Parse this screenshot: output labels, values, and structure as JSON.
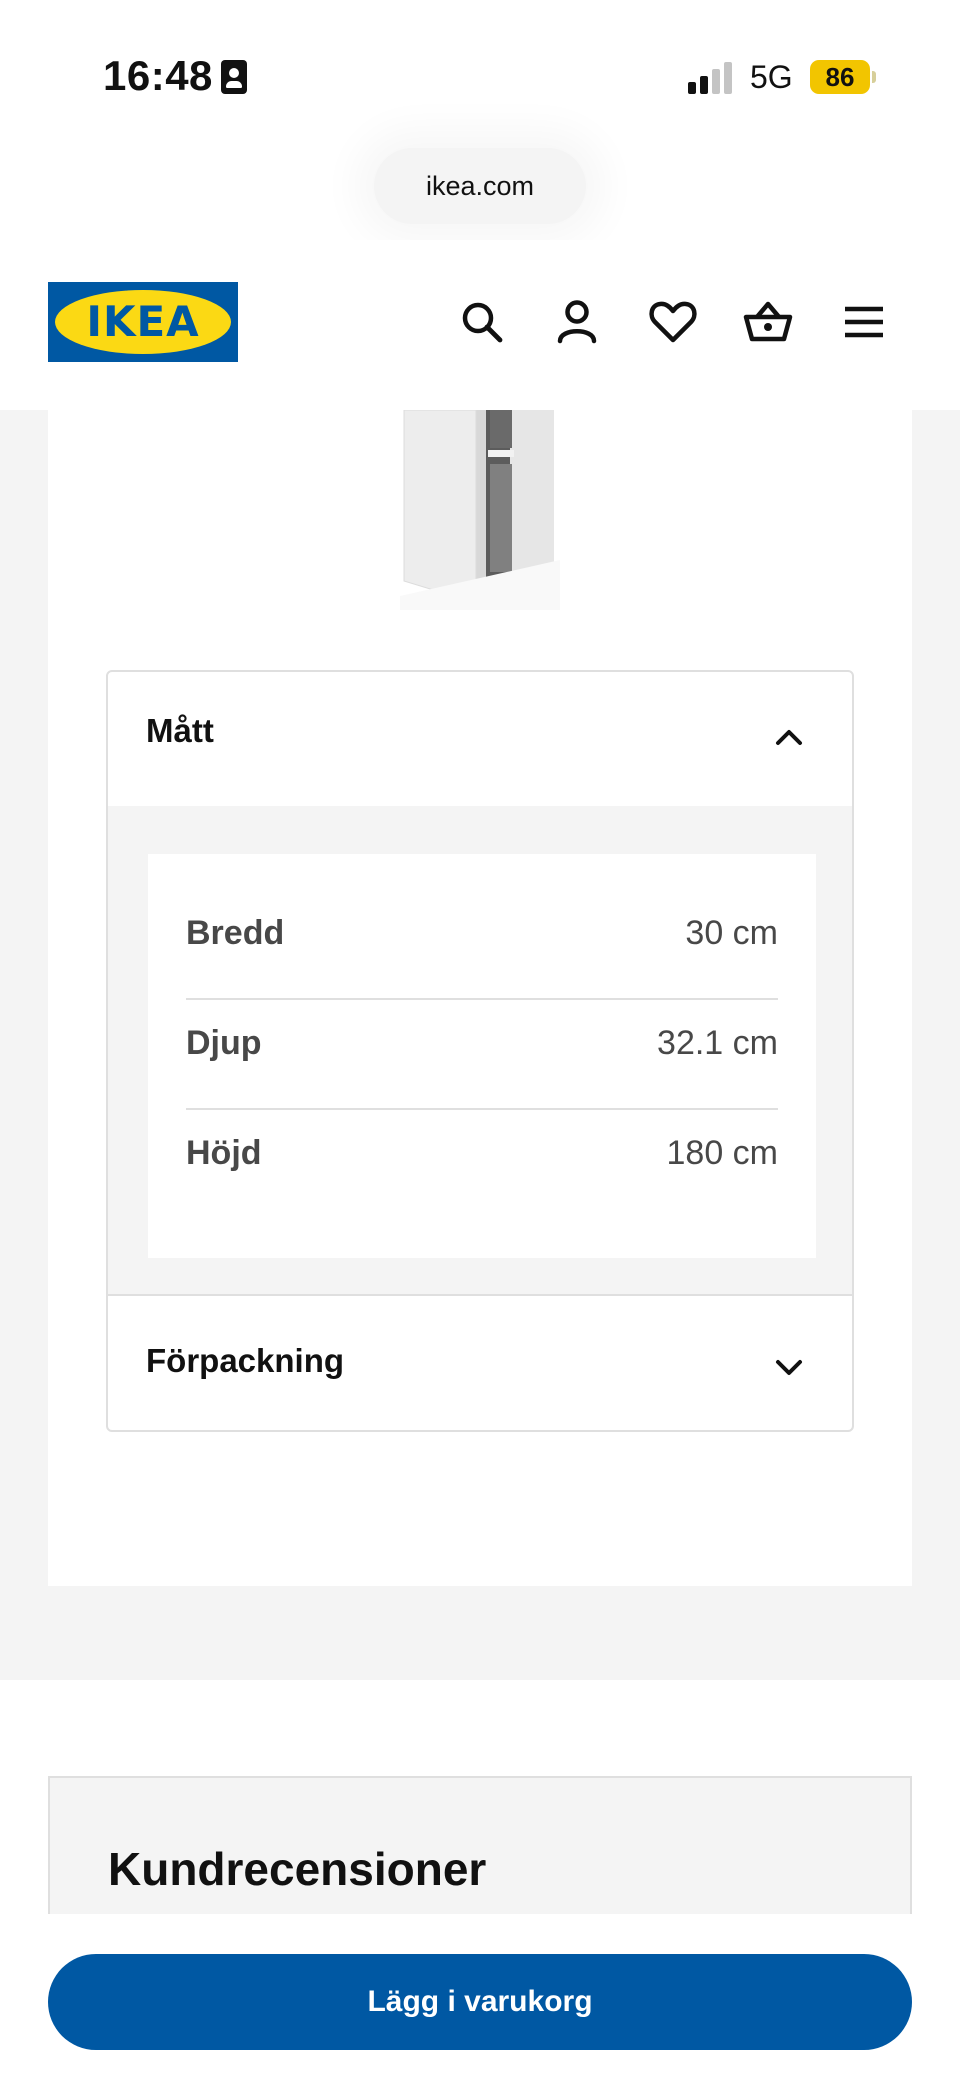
{
  "status_bar": {
    "time": "16:48",
    "network": "5G",
    "battery": "86",
    "signal_bars_active": 2,
    "signal_bars_total": 4
  },
  "browser": {
    "url": "ikea.com"
  },
  "header": {
    "logo_text": "IKEA",
    "icons": [
      "search-icon",
      "account-icon",
      "heart-icon",
      "basket-icon",
      "menu-icon"
    ],
    "brand_blue": "#0058a3",
    "brand_yellow": "#fbd914"
  },
  "accordion": {
    "dimensions": {
      "title": "Mått",
      "expanded": true,
      "rows": [
        {
          "label": "Bredd",
          "value": "30 cm"
        },
        {
          "label": "Djup",
          "value": "32.1 cm"
        },
        {
          "label": "Höjd",
          "value": "180 cm"
        }
      ]
    },
    "packaging": {
      "title": "Förpackning",
      "expanded": false
    }
  },
  "reviews": {
    "title": "Kundrecensioner"
  },
  "cta": {
    "label": "Lägg i varukorg"
  }
}
